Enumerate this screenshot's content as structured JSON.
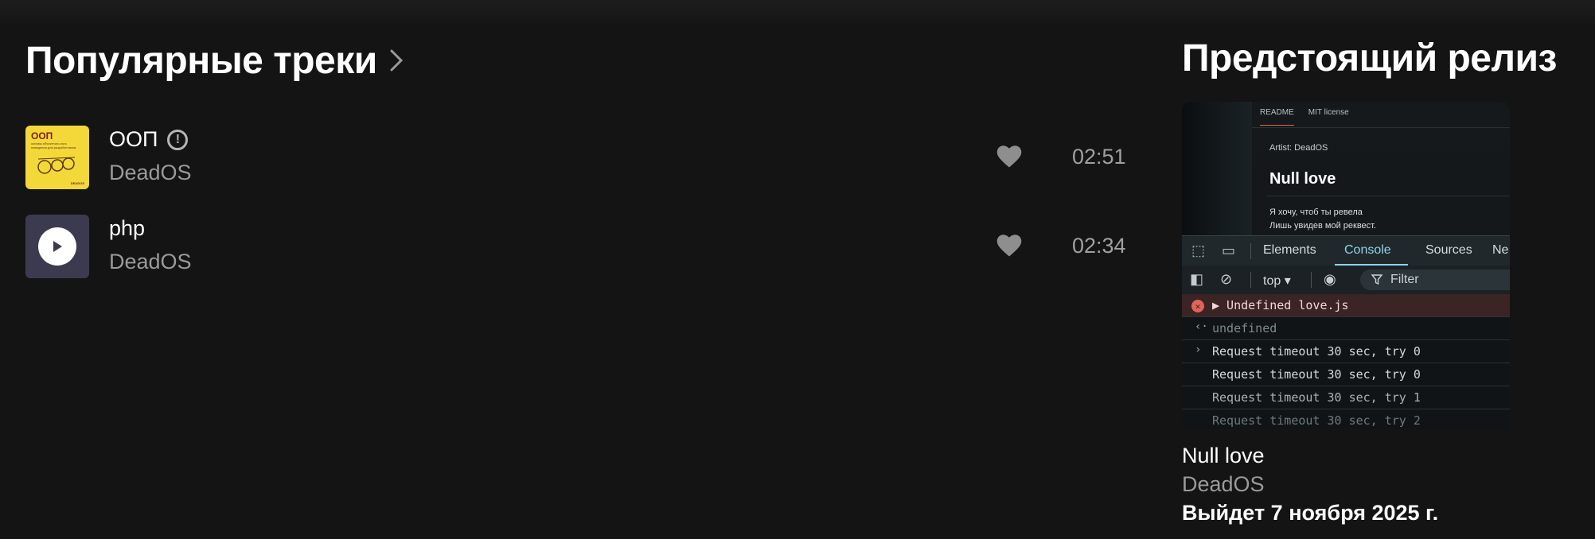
{
  "popular": {
    "title": "Популярные треки",
    "tracks": [
      {
        "title": "ООП",
        "artist": "DeadOS",
        "duration": "02:51",
        "explicit": true,
        "cover": "yellow-oop-cover"
      },
      {
        "title": "php",
        "artist": "DeadOS",
        "duration": "02:34",
        "explicit": false,
        "cover": "purple-play-cover"
      }
    ]
  },
  "cover_oop": {
    "title": "ООП",
    "subtitle": "основы объектного-ного поведения для разработчиков",
    "brand": "DEADOS"
  },
  "upcoming": {
    "title": "Предстоящий релиз",
    "release_title": "Null love",
    "release_artist": "DeadOS",
    "release_date": "Выйдет 7 ноября 2025 г.",
    "cover": {
      "tabs": [
        "README",
        "MIT license"
      ],
      "artist_line": "Artist: DeadOS",
      "song": "Null love",
      "lyrics": [
        "Я хочу, чтоб ты ревела",
        "Лишь увидев мой реквест."
      ],
      "devtools_tabs": [
        "Elements",
        "Console",
        "Sources",
        "Ne"
      ],
      "context": "top ▾",
      "filter": "Filter",
      "console_lines": [
        "▶ Undefined love.js",
        "undefined",
        "Request timeout 30 sec, try 0",
        "Request timeout 30 sec, try 0",
        "Request timeout 30 sec, try 1",
        "Request timeout 30 sec, try 2"
      ]
    }
  },
  "colors": {
    "background": "#141414",
    "muted_text": "#9a9a9a",
    "console_accent": "#8fd3ea"
  }
}
